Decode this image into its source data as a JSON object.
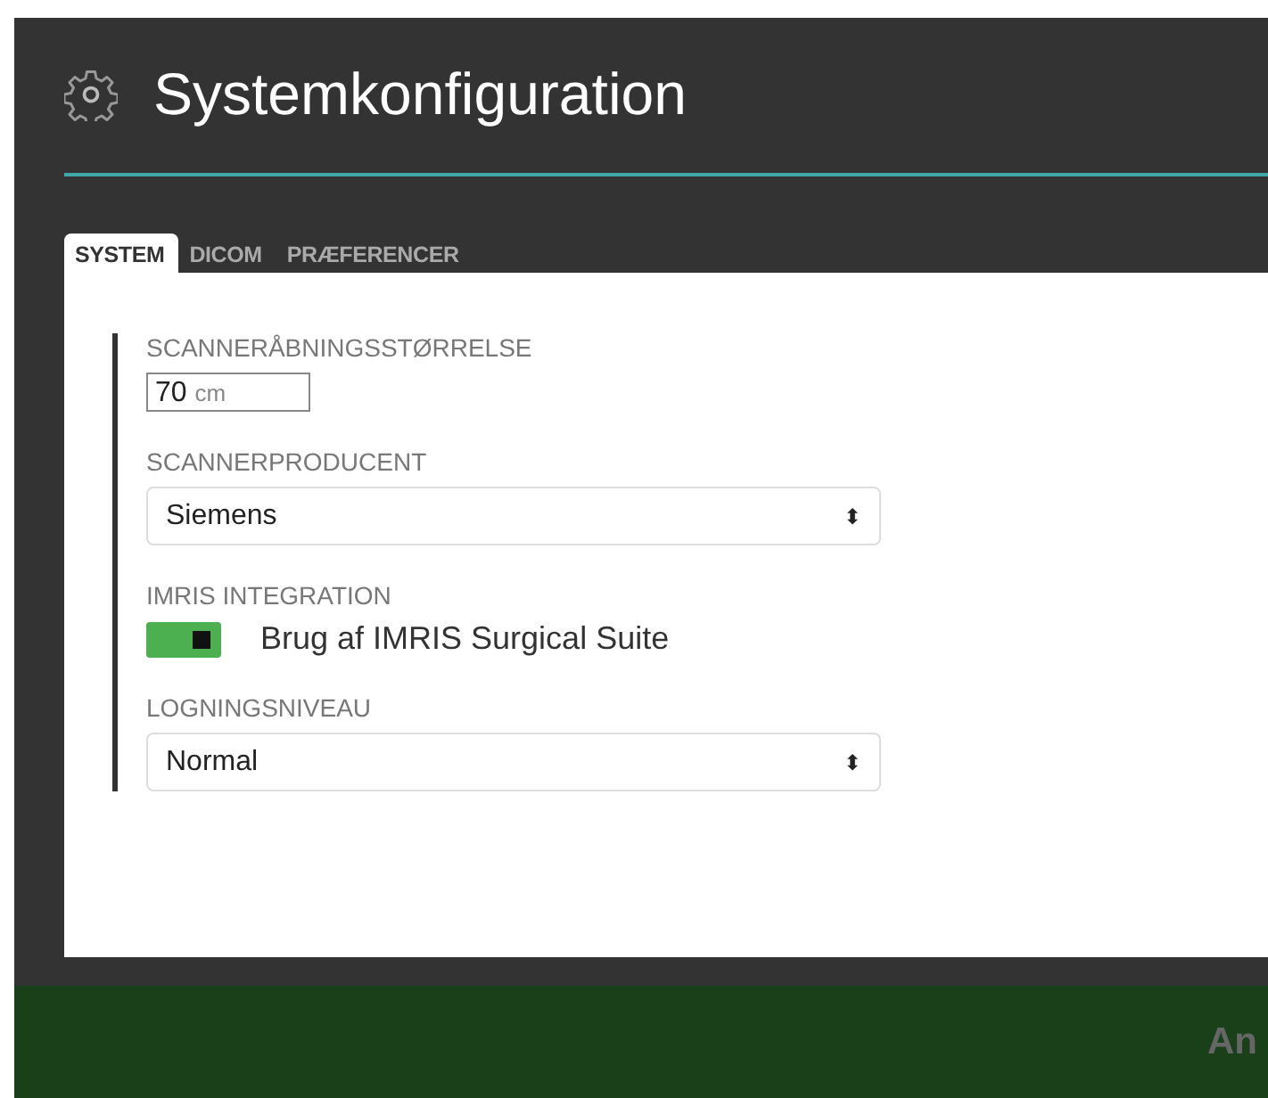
{
  "header": {
    "title": "Systemkonfiguration"
  },
  "tabs": [
    {
      "label": "SYSTEM",
      "selected": true
    },
    {
      "label": "DICOM",
      "selected": false
    },
    {
      "label": "PRÆFERENCER",
      "selected": false
    }
  ],
  "fields": [
    {
      "kind": "number",
      "label": "SCANNERÅBNINGSSTØRRELSE",
      "value": "70",
      "unit": "cm"
    },
    {
      "kind": "select",
      "label": "SCANNERPRODUCENT",
      "value": "Siemens",
      "caret": "⬍"
    },
    {
      "kind": "toggle",
      "label": "IMRIS INTEGRATION",
      "text": "Brug af IMRIS Surgical Suite",
      "on": true
    },
    {
      "kind": "select",
      "label": "LOGNINGSNIVEAU",
      "value": "Normal",
      "caret": "⬍"
    }
  ],
  "footer": {
    "button": "An"
  }
}
